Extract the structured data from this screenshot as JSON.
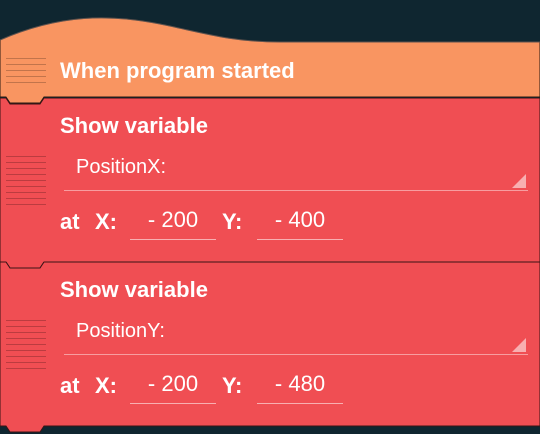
{
  "colors": {
    "background": "#0f2630",
    "event_brick": "#f99561",
    "look_brick": "#f04e53"
  },
  "event_brick": {
    "label": "When program started"
  },
  "bricks": [
    {
      "title": "Show variable",
      "variable": "PositionX:",
      "at_label": "at",
      "x_label": "X:",
      "x_value": "- 200",
      "y_label": "Y:",
      "y_value": "- 400"
    },
    {
      "title": "Show variable",
      "variable": "PositionY:",
      "at_label": "at",
      "x_label": "X:",
      "x_value": "- 200",
      "y_label": "Y:",
      "y_value": "- 480"
    }
  ]
}
